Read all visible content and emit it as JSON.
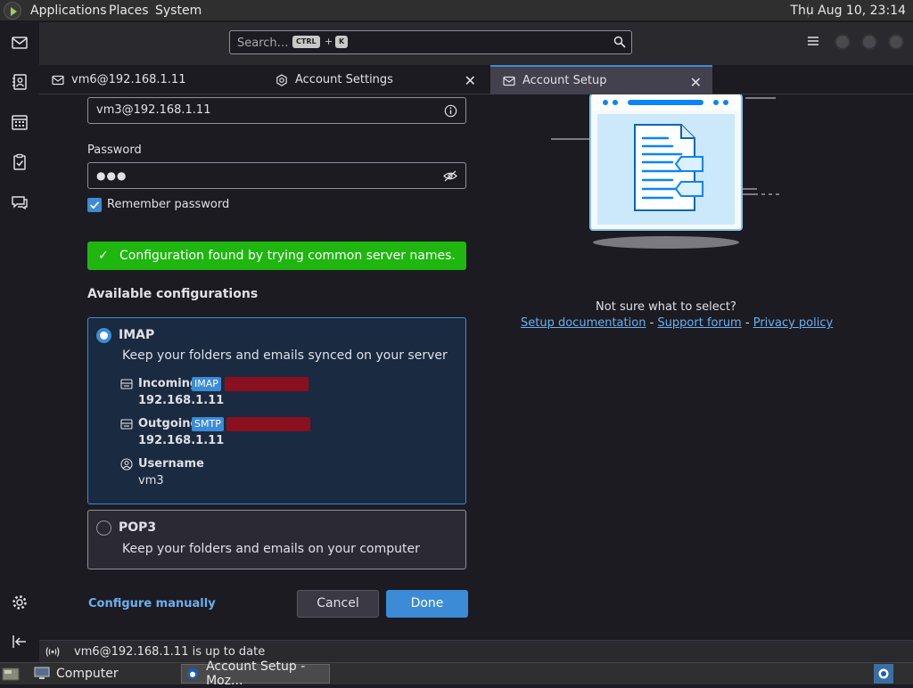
{
  "system_panel": {
    "menus": [
      "Applications",
      "Places",
      "System"
    ],
    "clock": "Thu Aug 10, 23:14"
  },
  "toolbar": {
    "search_placeholder": "Search…",
    "shortcut_keys": [
      "CTRL",
      "K"
    ],
    "shortcut_plus": "+"
  },
  "tabs": [
    {
      "label": "vm6@192.168.1.11",
      "icon": "mail-icon",
      "closable": false
    },
    {
      "label": "Account Settings",
      "icon": "gear-icon",
      "closable": true
    },
    {
      "label": "Account Setup",
      "icon": "mail-setup-icon",
      "closable": true,
      "active": true
    }
  ],
  "tab_close_glyph": "✕",
  "form": {
    "email_value": "vm3@192.168.1.11",
    "password_label": "Password",
    "password_value": "●●●",
    "remember_label": "Remember password",
    "remember_checked": true
  },
  "notification": {
    "text": "Configuration found by trying common server names."
  },
  "configs": {
    "title": "Available configurations",
    "imap": {
      "name": "IMAP",
      "description": "Keep your folders and emails synced on your server",
      "incoming_label": "Incoming",
      "incoming_protocol": "IMAP",
      "incoming_host": "192.168.1.11",
      "outgoing_label": "Outgoing",
      "outgoing_protocol": "SMTP",
      "outgoing_host": "192.168.1.11",
      "username_label": "Username",
      "username_value": "vm3",
      "selected": true
    },
    "pop3": {
      "name": "POP3",
      "description": "Keep your folders and emails on your computer",
      "selected": false
    }
  },
  "actions": {
    "configure_manually": "Configure manually",
    "cancel": "Cancel",
    "done": "Done"
  },
  "help": {
    "question": "Not sure what to select?",
    "links": [
      "Setup documentation",
      "Support forum",
      "Privacy policy"
    ],
    "separator": "-"
  },
  "statusbar": {
    "text": "vm6@192.168.1.11 is up to date"
  },
  "taskbar": {
    "computer_label": "Computer",
    "window_label": "Account Setup - Moz..."
  },
  "colors": {
    "accent": "#3b8bd6",
    "success": "#1eb60f",
    "warning_badge": "#8a1020"
  }
}
